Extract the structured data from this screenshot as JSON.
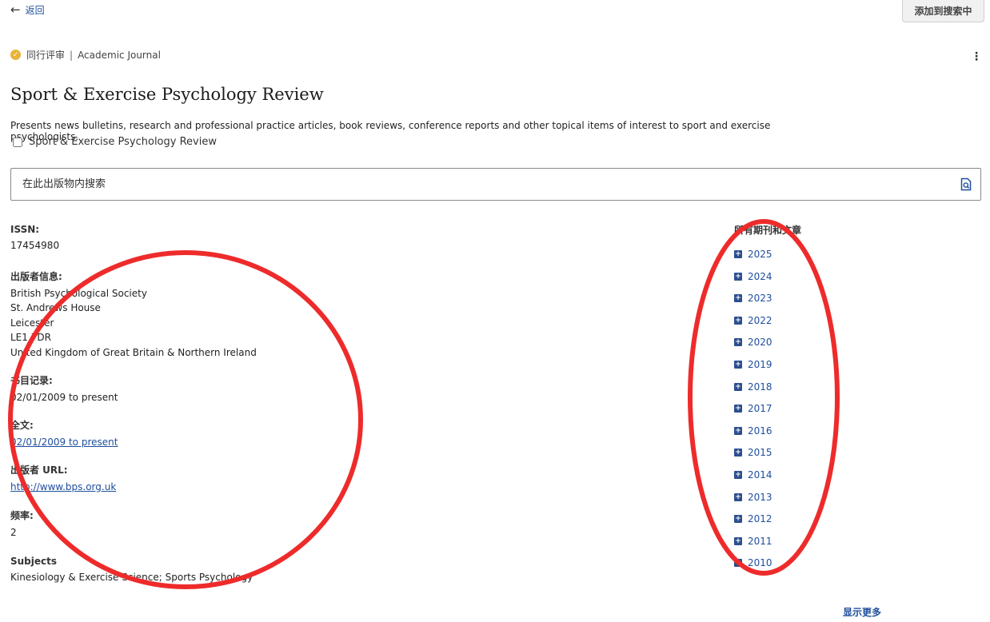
{
  "header": {
    "back_label": "返回",
    "add_to_search_label": "添加到搜索中"
  },
  "publication": {
    "peer_review": "同行评审",
    "type": "Academic Journal",
    "title": "Sport & Exercise Psychology Review",
    "description": "Presents news bulletins, research and professional practice articles, book reviews, conference reports and other topical items of interest to sport and exercise psychologists.",
    "checkbox_label": "Sport & Exercise Psychology Review"
  },
  "search": {
    "placeholder": "在此出版物内搜索"
  },
  "details": {
    "issn_label": "ISSN:",
    "issn_value": "17454980",
    "publisher_label": "出版者信息:",
    "publisher_lines": [
      "British Psychological Society",
      "St. Andrews House",
      "Leicester",
      "LE1 7DR",
      "United Kingdom of Great Britain & Northern Ireland"
    ],
    "records_label": "书目记录:",
    "records_value": "02/01/2009 to present",
    "fulltext_label": "全文:",
    "fulltext_value": "02/01/2009 to present",
    "url_label": "出版者 URL:",
    "url_value": "http://www.bps.org.uk",
    "frequency_label": "频率:",
    "frequency_value": "2",
    "subjects_label": "Subjects",
    "subjects_value": "Kinesiology & Exercise Science; Sports Psychology"
  },
  "issues": {
    "heading": "所有期刊和文章",
    "years": [
      "2025",
      "2024",
      "2023",
      "2022",
      "2020",
      "2019",
      "2018",
      "2017",
      "2016",
      "2015",
      "2014",
      "2013",
      "2012",
      "2011",
      "2010"
    ],
    "show_more": "显示更多"
  },
  "colors": {
    "link": "#1f4e9c",
    "annotation": "#ee2b2b",
    "peer_badge": "#e8b33a"
  }
}
